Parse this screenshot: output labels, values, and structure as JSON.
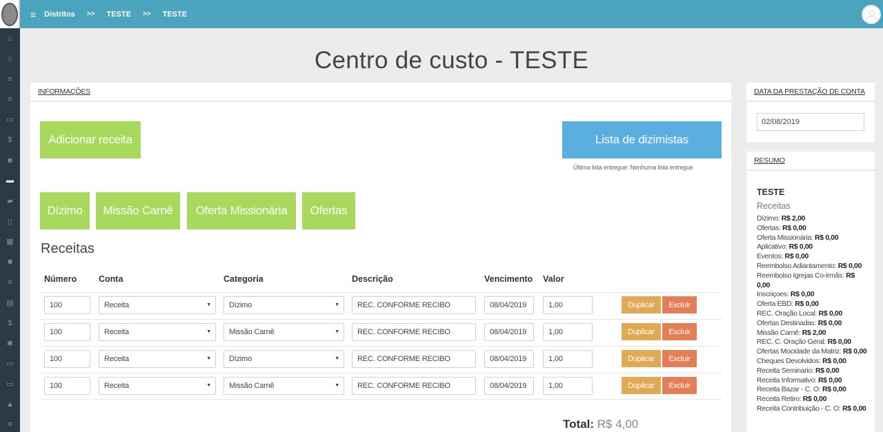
{
  "sidebar": {
    "icons": [
      "home-icon",
      "home-icon",
      "menu-icon",
      "menu-icon",
      "money-icon",
      "dollar-icon",
      "users-icon",
      "card-icon",
      "truck-icon",
      "mobile-icon",
      "calendar-icon",
      "users-icon",
      "menu-icon",
      "file-icon",
      "dollar-icon",
      "gear-icon",
      "money-icon",
      "money-icon",
      "lock-icon",
      "menu-icon"
    ],
    "glyphs": [
      "⌂",
      "⌂",
      "≡",
      "≡",
      "▭",
      "$",
      "☻",
      "▬",
      "▰",
      "▯",
      "▦",
      "☻",
      "≡",
      "▤",
      "$",
      "✱",
      "▭",
      "▭",
      "▲",
      "≡"
    ]
  },
  "topbar": {
    "menu_glyph": "≡",
    "breadcrumb": [
      "Distritos",
      "TESTE",
      "TESTE"
    ],
    "separator": ">>"
  },
  "page": {
    "title": "Centro de custo - TESTE"
  },
  "main": {
    "header": "INFORMAÇÕES",
    "add_receita": "Adicionar receita",
    "lista_dizimistas": "Lista de dizimistas",
    "ultima_lista": "Última lista entregue: Nenhuma lista entregue",
    "categories": [
      "Dízimo",
      "Missão Carnê",
      "Oferta Missionária",
      "Ofertas"
    ],
    "section_title": "Receitas",
    "columns": [
      "Número",
      "Conta",
      "Categoria",
      "Descrição",
      "Vencimento",
      "Valor"
    ],
    "rows": [
      {
        "numero": "100",
        "conta": "Receita",
        "categoria": "Dízimo",
        "descricao": "REC. CONFORME RECIBO",
        "vencimento": "08/04/2019",
        "valor": "1,00"
      },
      {
        "numero": "100",
        "conta": "Receita",
        "categoria": "Missão Carnê",
        "descricao": "REC. CONFORME RECIBO",
        "vencimento": "08/04/2019",
        "valor": "1,00"
      },
      {
        "numero": "100",
        "conta": "Receita",
        "categoria": "Dízimo",
        "descricao": "REC. CONFORME RECIBO",
        "vencimento": "08/04/2019",
        "valor": "1,00"
      },
      {
        "numero": "100",
        "conta": "Receita",
        "categoria": "Missão Carnê",
        "descricao": "REC. CONFORME RECIBO",
        "vencimento": "08/04/2019",
        "valor": "1,00"
      }
    ],
    "duplicar": "Duplicar",
    "excluir": "Excluir",
    "total_label": "Total:",
    "total_value": "R$ 4,00"
  },
  "date_panel": {
    "header": "DATA DA PRESTAÇÃO DE CONTA",
    "value": "02/08/2019"
  },
  "resumo": {
    "header": "RESUMO",
    "title": "TESTE",
    "subtitle": "Receitas",
    "items": [
      {
        "label": "Dízimo:",
        "value": "R$ 2,00"
      },
      {
        "label": "Ofertas:",
        "value": "R$ 0,00"
      },
      {
        "label": "Oferta Missionária:",
        "value": "R$ 0,00"
      },
      {
        "label": "Aplicativo:",
        "value": "R$ 0,00"
      },
      {
        "label": "Eventos:",
        "value": "R$ 0,00"
      },
      {
        "label": "Reembolso Adiantamento:",
        "value": "R$ 0,00"
      },
      {
        "label": "Reembolso Igrejas Co-irmãs:",
        "value": "R$ 0,00"
      },
      {
        "label": "Inscriçoes:",
        "value": "R$ 0,00"
      },
      {
        "label": "Oferta EBD:",
        "value": "R$ 0,00"
      },
      {
        "label": "REC. Oração Local:",
        "value": "R$ 0,00"
      },
      {
        "label": "Ofertas Destinadas:",
        "value": "R$ 0,00"
      },
      {
        "label": "Missão Carnê:",
        "value": "R$ 2,00"
      },
      {
        "label": "REC. C. Oração Geral:",
        "value": "R$ 0,00"
      },
      {
        "label": "Ofertas Mocidade da Matriz:",
        "value": "R$ 0,00"
      },
      {
        "label": "Cheques Devolvidos:",
        "value": "R$ 0,00"
      },
      {
        "label": "Receita Seminario:",
        "value": "R$ 0,00"
      },
      {
        "label": "Receita Informativo:",
        "value": "R$ 0,00"
      },
      {
        "label": "Receita Bazar - C. O:",
        "value": "R$ 0,00"
      },
      {
        "label": "Receita Retiro:",
        "value": "R$ 0,00"
      },
      {
        "label": "Receita Contribuição - C. O:",
        "value": "R$ 0,00"
      }
    ]
  }
}
